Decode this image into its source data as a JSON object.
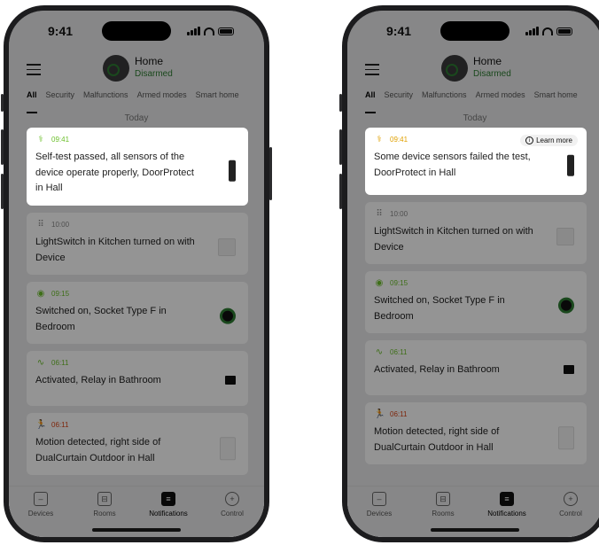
{
  "status": {
    "time": "9:41"
  },
  "header": {
    "title": "Home",
    "subtitle": "Disarmed"
  },
  "tabs": [
    "All",
    "Security",
    "Malfunctions",
    "Armed modes",
    "Smart home"
  ],
  "section": "Today",
  "left": {
    "cards": [
      {
        "time": "09:41",
        "message": "Self-test passed, all sensors of the device operate properly, DoorProtect in Hall",
        "icon": "stethoscope-icon"
      },
      {
        "time": "10:00",
        "message": "LightSwitch in Kitchen turned on with Device",
        "icon": "dots-grid-icon"
      },
      {
        "time": "09:15",
        "message": "Switched on, Socket Type F in Bedroom",
        "icon": "toggle-icon"
      },
      {
        "time": "06:11",
        "message": "Activated, Relay in Bathroom",
        "icon": "pulse-icon"
      },
      {
        "time": "06:11",
        "message": "Motion detected, right side of DualCurtain Outdoor in Hall",
        "icon": "running-icon"
      }
    ]
  },
  "right": {
    "learn_more": "Learn more",
    "cards": [
      {
        "time": "09:41",
        "message": "Some device sensors failed the test, DoorProtect in Hall",
        "icon": "stethoscope-icon"
      },
      {
        "time": "10:00",
        "message": "LightSwitch in Kitchen turned on with Device",
        "icon": "dots-grid-icon"
      },
      {
        "time": "09:15",
        "message": "Switched on, Socket Type F in Bedroom",
        "icon": "toggle-icon"
      },
      {
        "time": "06:11",
        "message": "Activated, Relay in Bathroom",
        "icon": "pulse-icon"
      },
      {
        "time": "06:11",
        "message": "Motion detected, right side of DualCurtain Outdoor in Hall",
        "icon": "running-icon"
      }
    ]
  },
  "nav": [
    "Devices",
    "Rooms",
    "Notifications",
    "Control"
  ],
  "colors": {
    "ok": "#6bbf2a",
    "warn": "#e0a000",
    "alert": "#d84315",
    "green": "#2e7d32"
  }
}
